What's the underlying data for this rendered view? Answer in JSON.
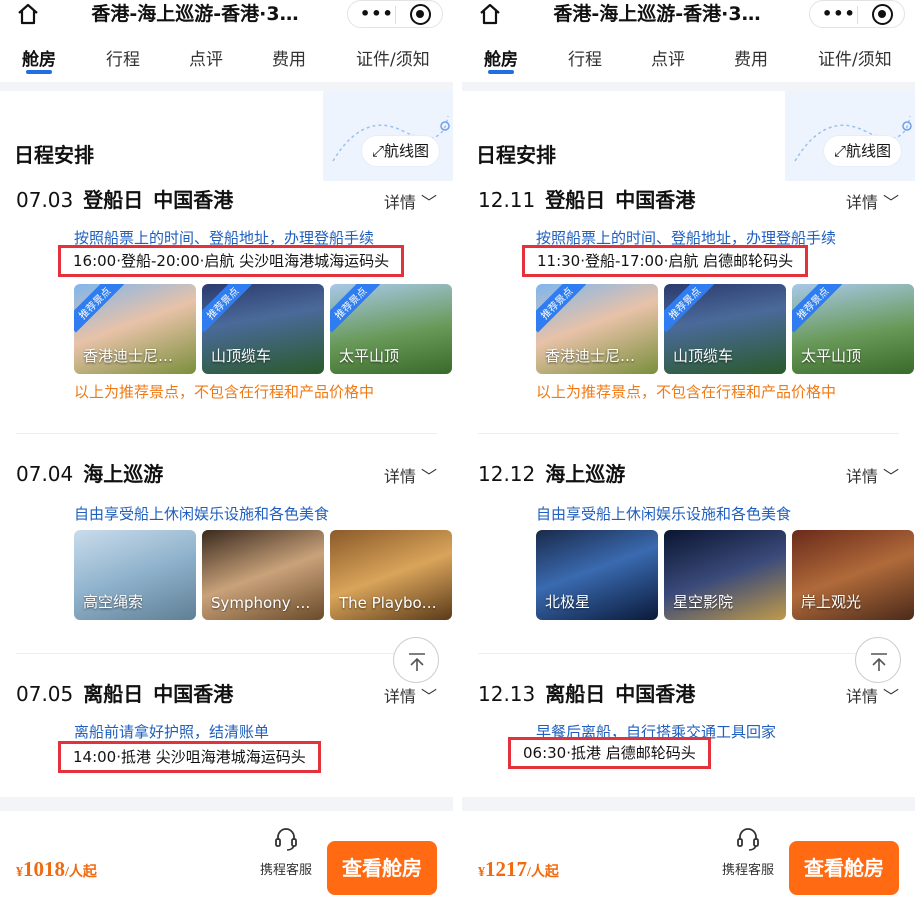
{
  "panels": [
    {
      "nav": {
        "title": "香港-海上巡游-香港·3…"
      },
      "tabs": [
        "舱房",
        "行程",
        "点评",
        "费用",
        "证件/须知"
      ],
      "section_title": "日程安排",
      "route_btn": "航线图",
      "days": [
        {
          "date": "07.03",
          "tag": "登船日",
          "place": "中国香港",
          "detail": "详情",
          "desc": "按照船票上的时间、登船地址，办理登船手续",
          "time": "16:00·登船-20:00·启航 尖沙咀海港城海运码头",
          "badge": "推荐景点",
          "thumbs": [
            "香港迪士尼…",
            "山顶缆车",
            "太平山顶"
          ],
          "note": "以上为推荐景点，不包含在行程和产品价格中"
        },
        {
          "date": "07.04",
          "tag": "",
          "place": "海上巡游",
          "detail": "详情",
          "desc": "自由享受船上休闲娱乐设施和各色美食",
          "thumbs": [
            "高空绳索",
            "Symphony …",
            "The Playbo…"
          ]
        },
        {
          "date": "07.05",
          "tag": "离船日",
          "place": "中国香港",
          "detail": "详情",
          "desc": "离船前请拿好护照，结清账单",
          "time": "14:00·抵港 尖沙咀海港城海运码头"
        }
      ],
      "footer": {
        "currency": "¥",
        "amount": "1018",
        "unit": "/人起",
        "service": "携程客服",
        "book": "查看舱房"
      }
    },
    {
      "nav": {
        "title": "香港-海上巡游-香港·3…"
      },
      "tabs": [
        "舱房",
        "行程",
        "点评",
        "费用",
        "证件/须知"
      ],
      "section_title": "日程安排",
      "route_btn": "航线图",
      "days": [
        {
          "date": "12.11",
          "tag": "登船日",
          "place": "中国香港",
          "detail": "详情",
          "desc": "按照船票上的时间、登船地址，办理登船手续",
          "time": "11:30·登船-17:00·启航 启德邮轮码头",
          "badge": "推荐景点",
          "thumbs": [
            "香港迪士尼…",
            "山顶缆车",
            "太平山顶"
          ],
          "note": "以上为推荐景点，不包含在行程和产品价格中"
        },
        {
          "date": "12.12",
          "tag": "",
          "place": "海上巡游",
          "detail": "详情",
          "desc": "自由享受船上休闲娱乐设施和各色美食",
          "thumbs": [
            "北极星",
            "星空影院",
            "岸上观光"
          ]
        },
        {
          "date": "12.13",
          "tag": "离船日",
          "place": "中国香港",
          "detail": "详情",
          "desc": "早餐后离船，自行搭乘交通工具回家",
          "time": "06:30·抵港 启德邮轮码头"
        }
      ],
      "footer": {
        "currency": "¥",
        "amount": "1217",
        "unit": "/人起",
        "service": "携程客服",
        "book": "查看舱房"
      }
    }
  ]
}
